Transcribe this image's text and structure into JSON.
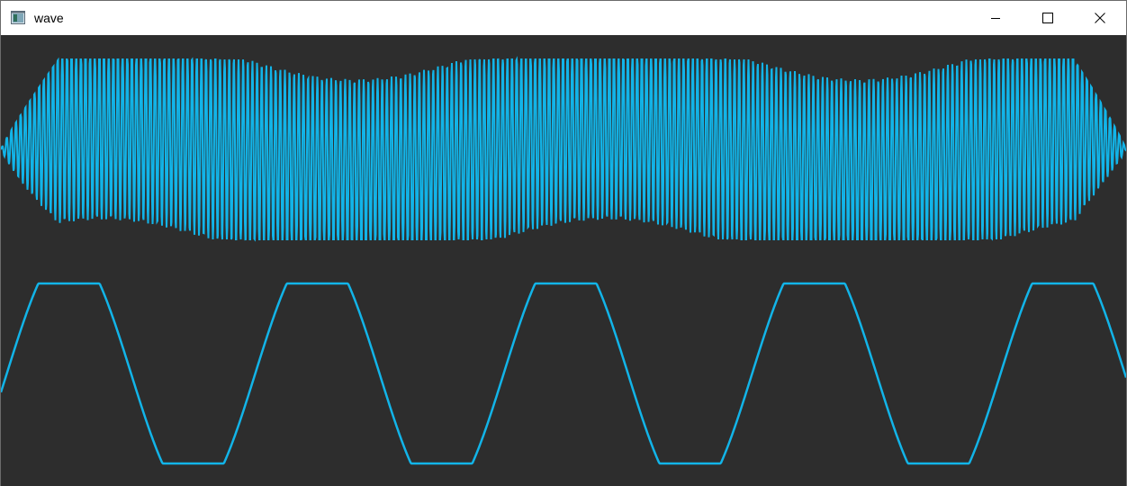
{
  "window": {
    "title": "wave",
    "icon": "app-window-icon",
    "controls": [
      "minimize-icon",
      "maximize-icon",
      "close-icon"
    ]
  },
  "colors": {
    "background": "#2d2d2d",
    "trace": "#12b4e8",
    "titlebar": "#ffffff"
  }
}
